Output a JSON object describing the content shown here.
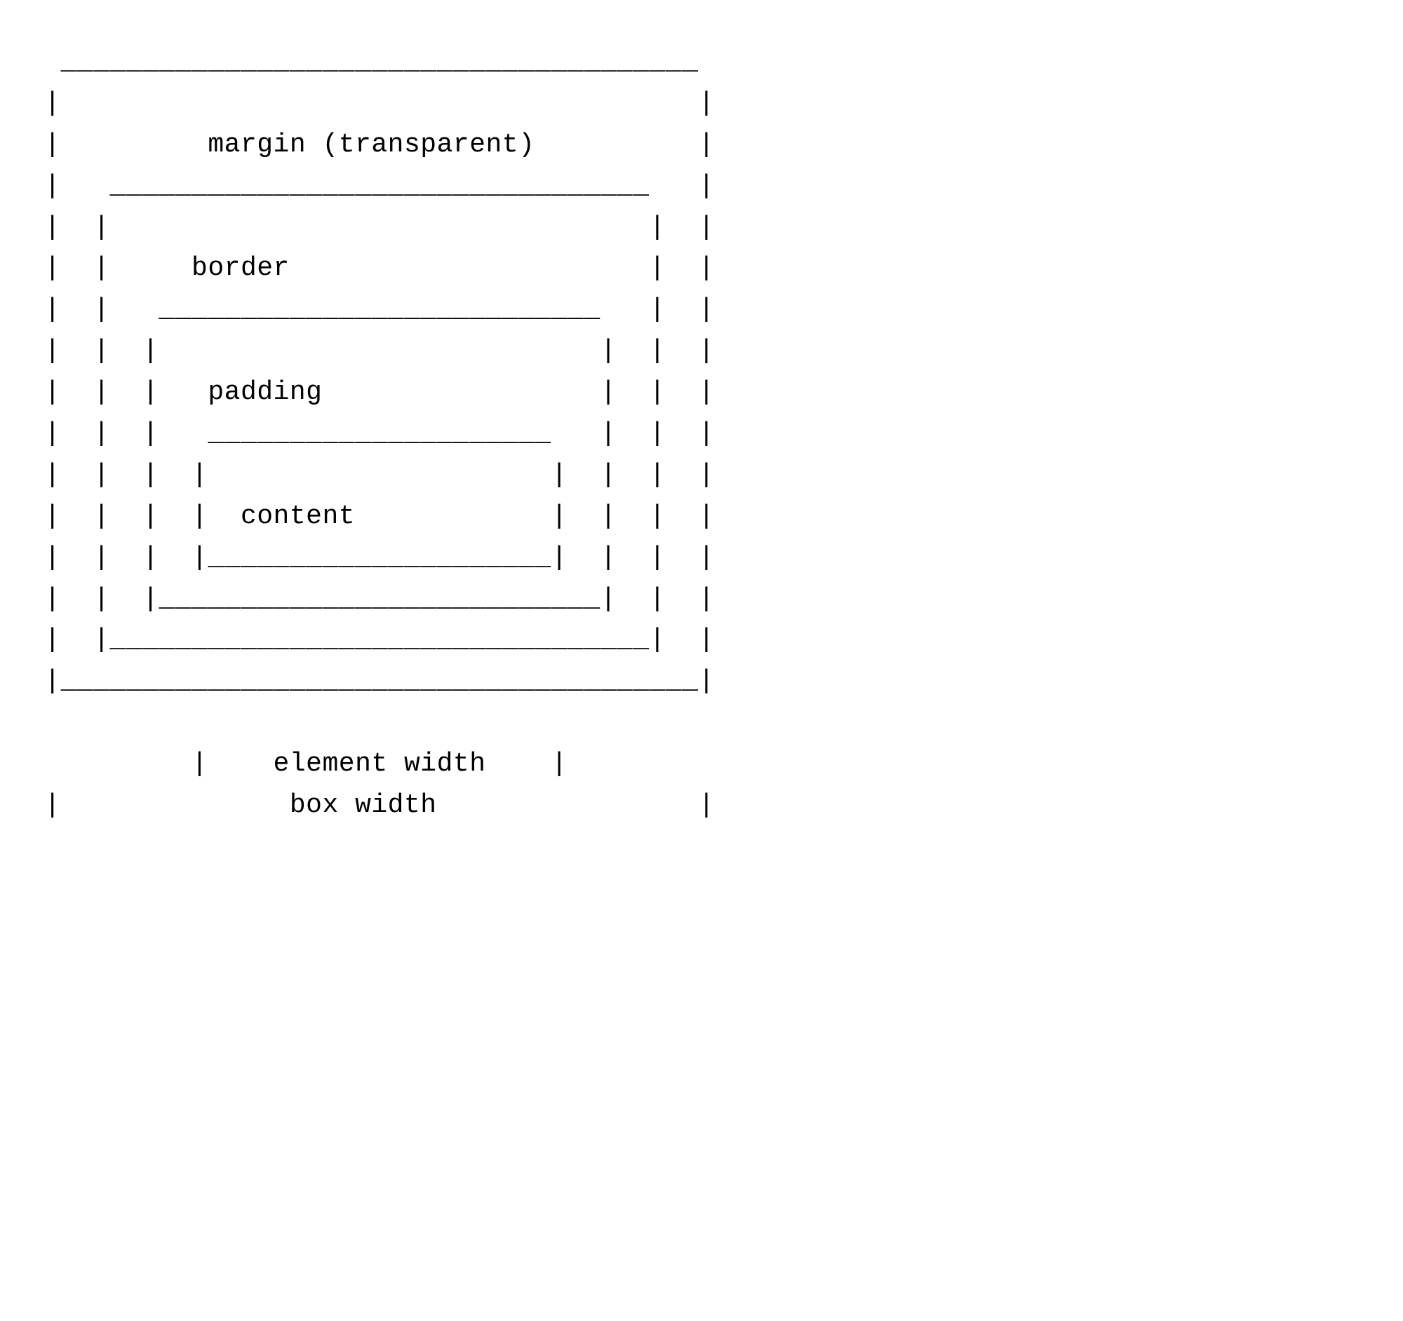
{
  "diagram": {
    "type": "css-box-model",
    "labels": {
      "margin": "margin (transparent)",
      "border": "border",
      "padding": "padding",
      "content": "content",
      "element_width": "element width",
      "box_width": "box width"
    },
    "ascii_lines": [
      "  _______________________________________",
      " |                                       |",
      " |         margin (transparent)          |",
      " |   _________________________________   |",
      " |  |                                 |  |",
      " |  |     border                      |  |",
      " |  |   ___________________________   |  |",
      " |  |  |                           |  |  |",
      " |  |  |   padding                 |  |  |",
      " |  |  |   _____________________   |  |  |",
      " |  |  |  |                     |  |  |  |",
      " |  |  |  |  content            |  |  |  |",
      " |  |  |  |_____________________|  |  |  |",
      " |  |  |___________________________|  |  |",
      " |  |_________________________________|  |",
      " |_______________________________________|",
      "",
      "          |    element width    |",
      " |              box width                |"
    ]
  }
}
